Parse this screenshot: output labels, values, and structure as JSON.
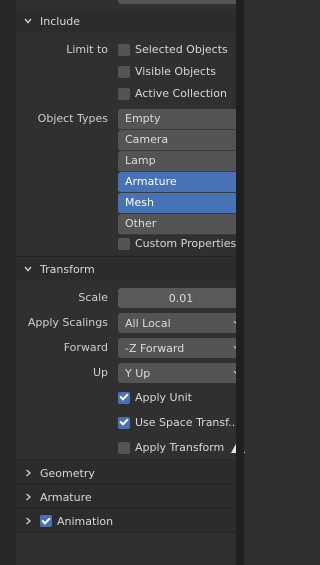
{
  "include": {
    "title": "Include",
    "limit_to_label": "Limit to",
    "limit_options": [
      {
        "label": "Selected Objects",
        "checked": false
      },
      {
        "label": "Visible Objects",
        "checked": false
      },
      {
        "label": "Active Collection",
        "checked": false
      }
    ],
    "object_types_label": "Object Types",
    "object_types": [
      {
        "label": "Empty",
        "selected": false
      },
      {
        "label": "Camera",
        "selected": false
      },
      {
        "label": "Lamp",
        "selected": false
      },
      {
        "label": "Armature",
        "selected": true
      },
      {
        "label": "Mesh",
        "selected": true
      },
      {
        "label": "Other",
        "selected": false
      }
    ],
    "custom_properties": {
      "label": "Custom Properties",
      "checked": false
    }
  },
  "transform": {
    "title": "Transform",
    "scale_label": "Scale",
    "scale_value": "0.01",
    "apply_scalings_label": "Apply Scalings",
    "apply_scalings_value": "All Local",
    "forward_label": "Forward",
    "forward_value": "-Z Forward",
    "up_label": "Up",
    "up_value": "Y Up",
    "apply_unit": {
      "label": "Apply Unit",
      "checked": true
    },
    "use_space_transform": {
      "label": "Use Space Transf...",
      "checked": true
    },
    "apply_transform": {
      "label": "Apply Transform",
      "checked": false
    }
  },
  "collapsed_sections": {
    "geometry": "Geometry",
    "armature": "Armature",
    "animation": "Animation"
  },
  "icons": {
    "expanded": "chevron-down-icon",
    "collapsed": "chevron-right-icon",
    "warning": "warning-icon"
  },
  "colors": {
    "background": "#303030",
    "field": "#545454",
    "selected": "#4772b3",
    "header": "#2c2c2c"
  }
}
